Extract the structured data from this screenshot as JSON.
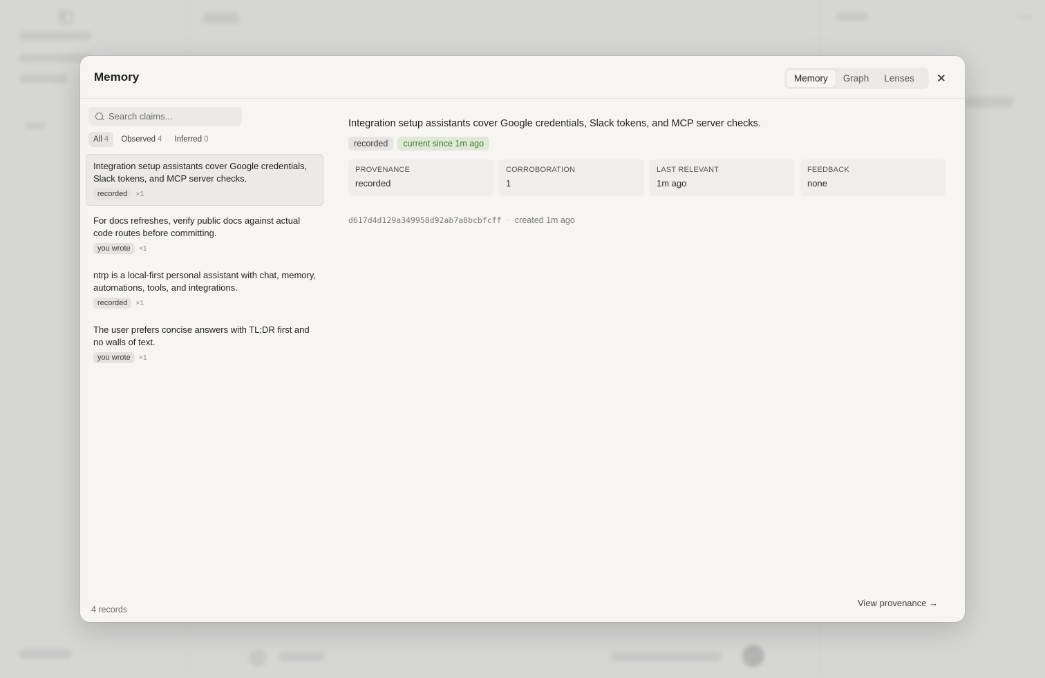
{
  "modal": {
    "title": "Memory",
    "tabs": [
      {
        "label": "Memory",
        "active": true
      },
      {
        "label": "Graph",
        "active": false
      },
      {
        "label": "Lenses",
        "active": false
      }
    ]
  },
  "search": {
    "placeholder": "Search claims..."
  },
  "filters": [
    {
      "label": "All",
      "count": "4",
      "active": true
    },
    {
      "label": "Observed",
      "count": "4",
      "active": false
    },
    {
      "label": "Inferred",
      "count": "0",
      "active": false
    }
  ],
  "claims": [
    {
      "text": "Integration setup assistants cover Google credentials, Slack tokens, and MCP server checks.",
      "tag": "recorded",
      "count": "×1",
      "selected": true
    },
    {
      "text": "For docs refreshes, verify public docs against actual code routes before committing.",
      "tag": "you wrote",
      "count": "×1",
      "selected": false
    },
    {
      "text": "ntrp is a local-first personal assistant with chat, memory, automations, tools, and integrations.",
      "tag": "recorded",
      "count": "×1",
      "selected": false
    },
    {
      "text": "The user prefers concise answers with TL;DR first and no walls of text.",
      "tag": "you wrote",
      "count": "×1",
      "selected": false
    }
  ],
  "records_label": "4 records",
  "detail": {
    "text": "Integration setup assistants cover Google credentials, Slack tokens, and MCP server checks.",
    "badges": [
      {
        "label": "recorded",
        "color": "#e6e5e1"
      },
      {
        "label": "current since 1m ago",
        "color": "#dfe9d6"
      }
    ],
    "stats": [
      {
        "label": "PROVENANCE",
        "value": "recorded"
      },
      {
        "label": "CORROBORATION",
        "value": "1"
      },
      {
        "label": "LAST RELEVANT",
        "value": "1m ago"
      },
      {
        "label": "FEEDBACK",
        "value": "none"
      }
    ],
    "hash": "d617d4d129a349958d92ab7a8bcbfcff",
    "separator": "·",
    "created": "created 1m ago"
  },
  "view_provenance": "View provenance →",
  "background_more": "···"
}
